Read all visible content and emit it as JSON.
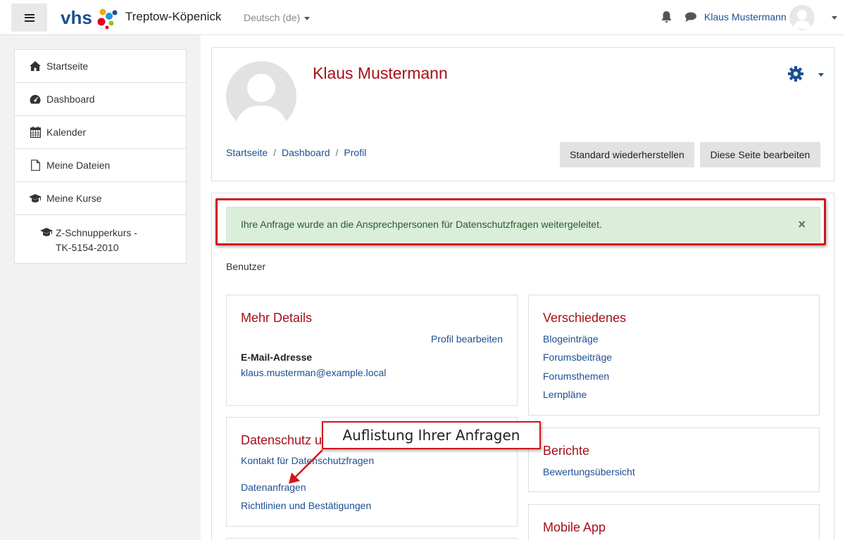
{
  "navbar": {
    "logo_text": "vhs",
    "brand": "Treptow-Köpenick",
    "language": "Deutsch (de)",
    "user_name": "Klaus Mustermann"
  },
  "sidebar": {
    "items": [
      {
        "label": "Startseite",
        "icon": "home-icon"
      },
      {
        "label": "Dashboard",
        "icon": "dashboard-icon"
      },
      {
        "label": "Kalender",
        "icon": "calendar-icon"
      },
      {
        "label": "Meine Dateien",
        "icon": "file-icon"
      },
      {
        "label": "Meine Kurse",
        "icon": "graduation-cap-icon"
      }
    ],
    "course": {
      "line1": "Z-Schnupperkurs -",
      "line2": "TK-5154-2010",
      "icon": "graduation-cap-icon"
    }
  },
  "header": {
    "name": "Klaus Mustermann",
    "breadcrumb": [
      "Startseite",
      "Dashboard",
      "Profil"
    ],
    "btn_reset": "Standard wiederherstellen",
    "btn_edit": "Diese Seite bearbeiten"
  },
  "alert": {
    "message": "Ihre Anfrage wurde an die Ansprechpersonen für Datenschutzfragen weitergeleitet.",
    "close": "×"
  },
  "section_label": "Benutzer",
  "details": {
    "title": "Mehr Details",
    "edit_link": "Profil bearbeiten",
    "email_label": "E-Mail-Adresse",
    "email_value": "klaus.musterman@example.local"
  },
  "privacy": {
    "title": "Datenschutz u",
    "links": [
      "Kontakt für Datenschutzfragen",
      "Datenanfragen",
      "Richtlinien und Bestätigungen"
    ]
  },
  "misc": {
    "title": "Verschiedenes",
    "links": [
      "Blogeinträge",
      "Forumsbeiträge",
      "Forumsthemen",
      "Lernpläne"
    ]
  },
  "reports": {
    "title": "Berichte",
    "links": [
      "Bewertungsübersicht"
    ]
  },
  "mobile": {
    "title": "Mobile App"
  },
  "callout": {
    "text": "Auflistung Ihrer Anfragen"
  },
  "colors": {
    "accent_red": "#a60f19",
    "link_blue": "#1d4f91",
    "alert_green": "#dbeeda",
    "annotation_red": "#d2161c"
  }
}
